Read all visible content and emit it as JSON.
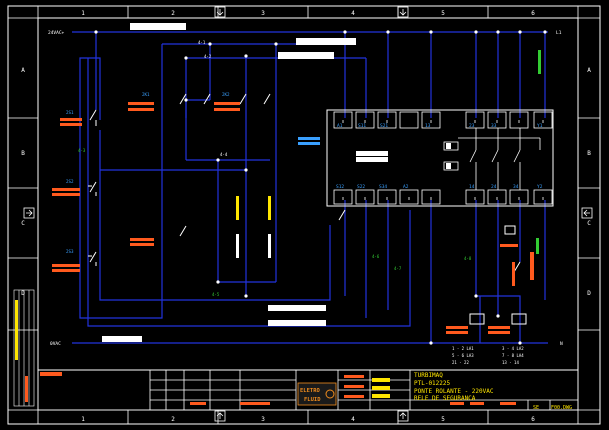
{
  "colors": {
    "background": "#000000",
    "frame": "#ffffff",
    "wire": "#2233dd",
    "label_cyan": "#3aa0ff",
    "label_red": "#ff5a1e",
    "label_green": "#33cc33",
    "label_yellow": "#ffe600",
    "bar_white": "#ffffff",
    "logo_orange": "#f08c1e"
  },
  "frame": {
    "top_cols": [
      "1",
      "2",
      "3",
      "4",
      "5",
      "6"
    ],
    "bottom_cols": [
      "1",
      "2",
      "3",
      "4",
      "5",
      "6"
    ],
    "rows": [
      "A",
      "B",
      "C",
      "D",
      "E"
    ]
  },
  "rails": {
    "top_left": "24VAC+",
    "top_right": "L1",
    "bottom_left": "0VAC",
    "bottom_right": "N"
  },
  "terminals": {
    "top": [
      "A1",
      "S11",
      "S21",
      "",
      "13",
      "23",
      "33",
      "Y1"
    ],
    "bottom": [
      "S12",
      "S22",
      "S34",
      "A2",
      "14",
      "24",
      "34",
      "Y2"
    ]
  },
  "relay_labels": [
    "2S1",
    "2K1",
    "2K2",
    "2S2",
    "2S3"
  ],
  "wire_labels": [
    "4-1",
    "4-2",
    "4-3",
    "4-4",
    "4-5",
    "4-6",
    "4-7",
    "4-8"
  ],
  "legend_rows": [
    {
      "left": "1 - 2 LA1",
      "right": "3 - 4 LA2"
    },
    {
      "left": "5 - 6 LA3",
      "right": "7 - 8 LA4"
    },
    {
      "left": "21 - 22",
      "right": "13 - 14"
    }
  ],
  "title_block": {
    "logo_top": "ELETRO",
    "logo_bottom": "FLUID",
    "line1": "TURBIMAQ",
    "line2": "PTL-012225",
    "line3": "PONTE ROLANTE - 220VAC",
    "line4": "RELE DE SEGURANCA",
    "sheet_label": "SE",
    "drawing": "F00.DWG"
  }
}
